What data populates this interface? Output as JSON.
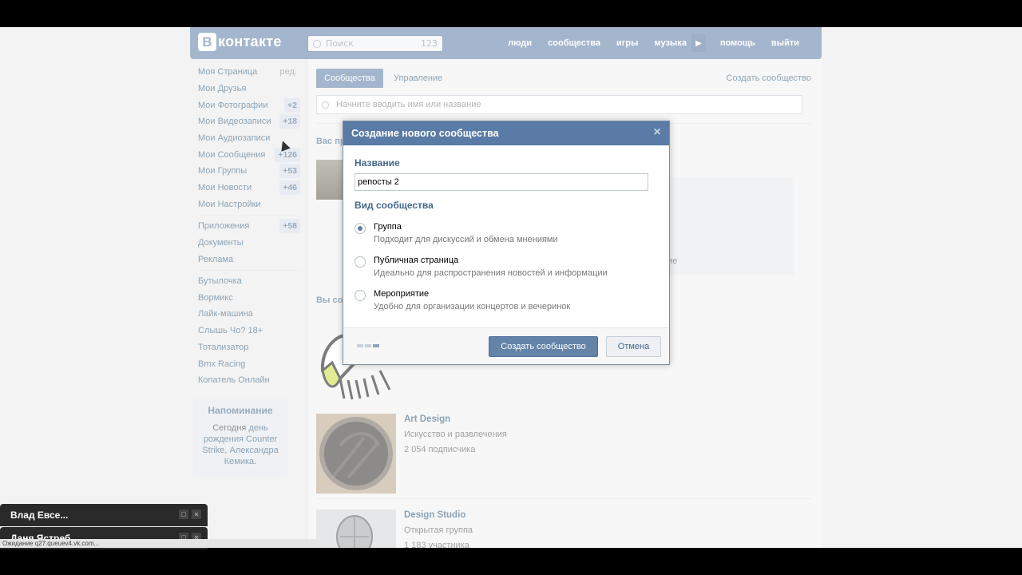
{
  "header": {
    "logo_letter": "B",
    "logo_text": "контакте",
    "search_placeholder": "Поиск",
    "search_count": "123",
    "nav": [
      "люди",
      "сообщества",
      "игры",
      "музыка",
      "помощь",
      "выйти"
    ]
  },
  "sidebar": {
    "edit_label": "ред.",
    "items": [
      {
        "label": "Моя Страница",
        "badge": ""
      },
      {
        "label": "Мои Друзья",
        "badge": ""
      },
      {
        "label": "Мои Фотографии",
        "badge": "+2"
      },
      {
        "label": "Мои Видеозаписи",
        "badge": "+18"
      },
      {
        "label": "Мои Аудиозаписи",
        "badge": ""
      },
      {
        "label": "Мои Сообщения",
        "badge": "+126"
      },
      {
        "label": "Мои Группы",
        "badge": "+53"
      },
      {
        "label": "Мои Новости",
        "badge": "+46"
      },
      {
        "label": "Мои Настройки",
        "badge": ""
      },
      {
        "label": "Приложения",
        "badge": "+58"
      },
      {
        "label": "Документы",
        "badge": ""
      },
      {
        "label": "Реклама",
        "badge": ""
      },
      {
        "label": "Бутылочка",
        "badge": ""
      },
      {
        "label": "Вормикс",
        "badge": ""
      },
      {
        "label": "Лайк-машина",
        "badge": ""
      },
      {
        "label": "Слышь Чо? 18+",
        "badge": ""
      },
      {
        "label": "Тотализатор",
        "badge": ""
      },
      {
        "label": "Bmx Racing",
        "badge": ""
      },
      {
        "label": "Копатель Онлайн",
        "badge": ""
      }
    ],
    "reminder": {
      "title": "Напоминание",
      "text_prefix": "Сегодня ",
      "birthday_link": "день рождения",
      "person1": "Counter Strike",
      "sep": ", ",
      "person2": "Александра Кемика",
      "suffix": "."
    }
  },
  "main": {
    "tab_active": "Сообщества",
    "tab_manage": "Управление",
    "create_link": "Создать сообщество",
    "filter_placeholder": "Начните вводить имя или название",
    "section1_partial": "Вас пр",
    "section2_partial": "Вы со",
    "bleed_text": "ие",
    "groups": [
      {
        "name": "Art Design",
        "category": "Искусство и развлечения",
        "subs": "2 054 подписчика"
      },
      {
        "name": "Design Studio",
        "category": "Открытая группа",
        "subs": "1 183 участника"
      }
    ]
  },
  "dialog": {
    "title": "Создание нового сообщества",
    "name_label": "Название",
    "name_value": "репосты 2",
    "type_label": "Вид сообщества",
    "options": [
      {
        "title": "Группа",
        "desc": "Подходит для дискуссий и обмена мнениями",
        "selected": true
      },
      {
        "title": "Публичная страница",
        "desc": "Идеально для распространения новостей и информации",
        "selected": false
      },
      {
        "title": "Мероприятие",
        "desc": "Удобно для организации концертов и вечеринок",
        "selected": false
      }
    ],
    "create_button": "Создать сообщество",
    "cancel_button": "Отмена"
  },
  "chat": {
    "tab1": "Влад Евсе...",
    "tab2": "Даня Ястреб..."
  },
  "status_text": "Ожидание q27.queuev4.vk.com...",
  "colors": {
    "brand": "#597ba5",
    "link": "#2b587a",
    "heading": "#45688e"
  }
}
